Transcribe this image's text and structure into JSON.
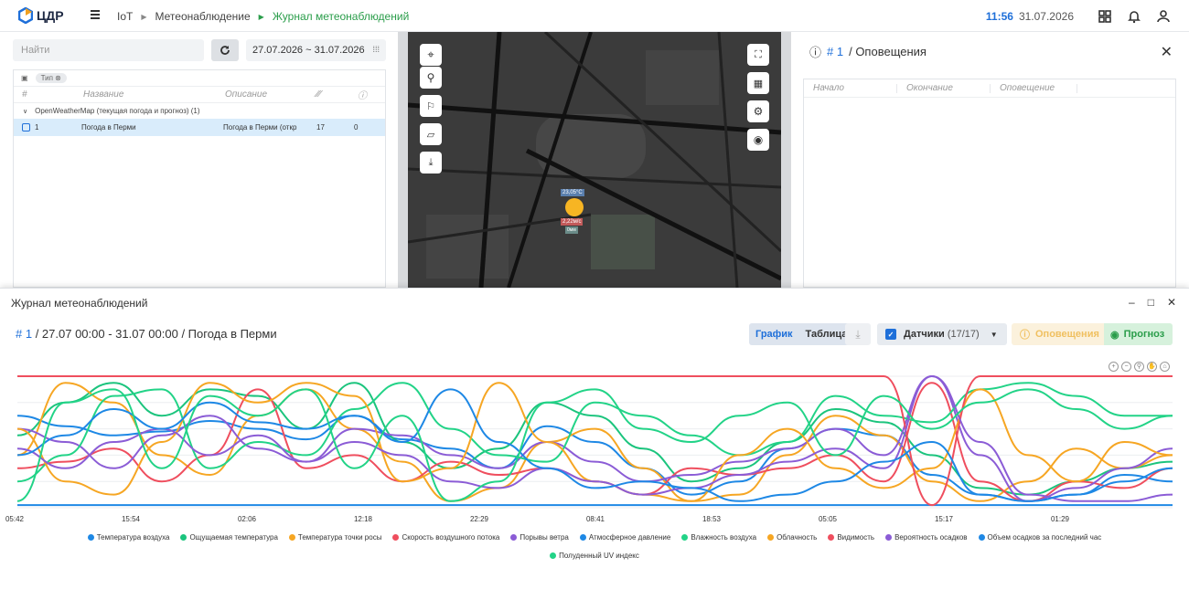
{
  "app": {
    "logo_text": "ЦДР"
  },
  "breadcrumbs": {
    "item1": "IoT",
    "item2": "Метеонаблюдение",
    "item3": "Журнал метеонаблюдений"
  },
  "header": {
    "time": "11:56",
    "date": "31.07.2026"
  },
  "left": {
    "search_placeholder": "Найти",
    "date_range": "27.07.2026 ~ 31.07.2026",
    "chip": "Тип",
    "columns": {
      "num": "#",
      "name": "Название",
      "desc": "Описание"
    },
    "group": "OpenWeatherMap (текущая погода и прогноз) (1)",
    "row": {
      "num": "1",
      "name": "Погода в Перми",
      "desc": "Погода в Перми (откр",
      "v1": "17",
      "v2": "0"
    }
  },
  "map": {
    "temp": "23,05°C",
    "wind": "2,22м/с",
    "v": "0мм"
  },
  "alerts_panel": {
    "num": "# 1",
    "title": "/ Оповещения",
    "columns": {
      "start": "Начало",
      "end": "Окончание",
      "alert": "Оповещение"
    }
  },
  "journal": {
    "title": "Журнал метеонаблюдений",
    "sub_num": "# 1",
    "sub_text": "/ 27.07 00:00 - 31.07 00:00 / Погода в Перми",
    "tab_chart": "График",
    "tab_table": "Таблица",
    "sensors_label": "Датчики",
    "sensors_count": "(17/17)",
    "alerts_label": "Оповещения",
    "forecast_label": "Прогноз"
  },
  "chart_data": {
    "type": "line",
    "x_ticks": [
      "05:42",
      "15:54",
      "02:06",
      "12:18",
      "22:29",
      "08:41",
      "18:53",
      "05:05",
      "15:17",
      "01:29"
    ],
    "series": [
      {
        "name": "Температура воздуха",
        "color": "#1e88e5",
        "values": [
          0.7,
          0.62,
          0.55,
          0.58,
          0.66,
          0.6,
          0.52,
          0.7,
          0.52,
          0.45,
          0.3,
          0.62,
          0.5,
          0.3,
          0.1,
          0.2,
          0.45,
          0.6,
          0.55,
          0.25,
          0.1,
          0.05,
          0.1,
          0.25,
          0.2
        ]
      },
      {
        "name": "Ощущаемая температура",
        "color": "#1bc47d",
        "values": [
          0.55,
          0.8,
          0.95,
          0.7,
          0.9,
          0.85,
          0.6,
          0.95,
          0.5,
          0.3,
          0.45,
          0.8,
          0.7,
          0.45,
          0.2,
          0.3,
          0.5,
          0.75,
          0.65,
          0.4,
          0.15,
          0.1,
          0.2,
          0.3,
          0.35
        ]
      },
      {
        "name": "Температура точки росы",
        "color": "#f6a623",
        "values": [
          0.4,
          0.95,
          0.8,
          0.4,
          0.25,
          0.7,
          0.9,
          0.6,
          0.35,
          0.05,
          0.15,
          0.5,
          0.6,
          0.3,
          0.05,
          0.1,
          0.4,
          0.7,
          0.55,
          0.2,
          0.05,
          0.2,
          0.45,
          0.3,
          0.4
        ]
      },
      {
        "name": "Скорость воздушного потока",
        "color": "#ef4e5e",
        "values": [
          0.3,
          0.35,
          0.45,
          0.2,
          0.4,
          0.9,
          0.3,
          0.4,
          0.2,
          0.35,
          0.25,
          0.3,
          0.2,
          0.1,
          0.3,
          0.25,
          0.3,
          0.4,
          0.2,
          0.95,
          0.2,
          0.05,
          0.2,
          0.15,
          0.3
        ]
      },
      {
        "name": "Порывы ветра",
        "color": "#8b5cd6",
        "values": [
          0.6,
          0.5,
          0.3,
          0.55,
          0.7,
          0.45,
          0.35,
          0.6,
          0.55,
          0.4,
          0.3,
          0.5,
          0.35,
          0.2,
          0.25,
          0.35,
          0.45,
          0.6,
          0.4,
          1.0,
          0.4,
          0.05,
          0.15,
          0.3,
          0.45
        ]
      },
      {
        "name": "Атмосферное давление",
        "color": "#1e88e5",
        "values": [
          0.02,
          0.02,
          0.02,
          0.02,
          0.02,
          0.02,
          0.02,
          0.02,
          0.02,
          0.02,
          0.02,
          0.02,
          0.02,
          0.02,
          0.02,
          0.02,
          0.02,
          0.02,
          0.02,
          0.02,
          0.02,
          0.02,
          0.02,
          0.02,
          0.02
        ]
      },
      {
        "name": "Влажность воздуха",
        "color": "#22d387",
        "values": [
          0.2,
          0.4,
          0.85,
          0.9,
          0.3,
          0.5,
          0.4,
          0.75,
          0.95,
          0.6,
          0.4,
          0.35,
          0.8,
          0.7,
          0.55,
          0.4,
          0.5,
          0.85,
          0.7,
          0.65,
          0.9,
          0.95,
          0.85,
          0.7,
          0.7
        ]
      },
      {
        "name": "Облачность",
        "color": "#f6a623",
        "values": [
          0.6,
          0.2,
          0.1,
          0.5,
          0.95,
          0.8,
          0.95,
          0.85,
          0.2,
          0.3,
          0.95,
          0.5,
          0.2,
          0.1,
          0.05,
          0.4,
          0.6,
          0.3,
          0.15,
          0.3,
          0.9,
          0.4,
          0.2,
          0.5,
          0.4
        ]
      },
      {
        "name": "Видимость",
        "color": "#ef4e5e",
        "values": [
          1.0,
          1.0,
          1.0,
          1.0,
          1.0,
          1.0,
          1.0,
          1.0,
          1.0,
          1.0,
          1.0,
          1.0,
          1.0,
          1.0,
          1.0,
          1.0,
          1.0,
          1.0,
          1.0,
          0.02,
          1.0,
          1.0,
          1.0,
          1.0,
          1.0
        ]
      },
      {
        "name": "Вероятность осадков",
        "color": "#8b5cd6",
        "values": [
          0.45,
          0.3,
          0.5,
          0.6,
          0.4,
          0.55,
          0.35,
          0.5,
          0.4,
          0.2,
          0.15,
          0.3,
          0.2,
          0.1,
          0.15,
          0.25,
          0.35,
          0.45,
          0.3,
          1.0,
          0.5,
          0.1,
          0.05,
          0.05,
          0.1
        ]
      },
      {
        "name": "Объем осадков за последний час",
        "color": "#1e88e5",
        "values": [
          0.4,
          0.55,
          0.75,
          0.6,
          0.8,
          0.65,
          0.6,
          0.7,
          0.5,
          0.9,
          0.5,
          0.3,
          0.15,
          0.2,
          0.15,
          0.05,
          0.1,
          0.2,
          0.35,
          0.5,
          0.1,
          0.05,
          0.1,
          0.2,
          0.3
        ]
      },
      {
        "name": "Полуденный UV индекс",
        "color": "#22d387",
        "values": [
          0.05,
          0.8,
          0.9,
          0.3,
          0.85,
          0.7,
          0.9,
          0.3,
          0.7,
          0.05,
          0.2,
          0.8,
          0.9,
          0.6,
          0.5,
          0.7,
          0.8,
          0.4,
          0.85,
          0.6,
          0.8,
          0.9,
          0.75,
          0.6,
          0.7
        ]
      }
    ]
  }
}
